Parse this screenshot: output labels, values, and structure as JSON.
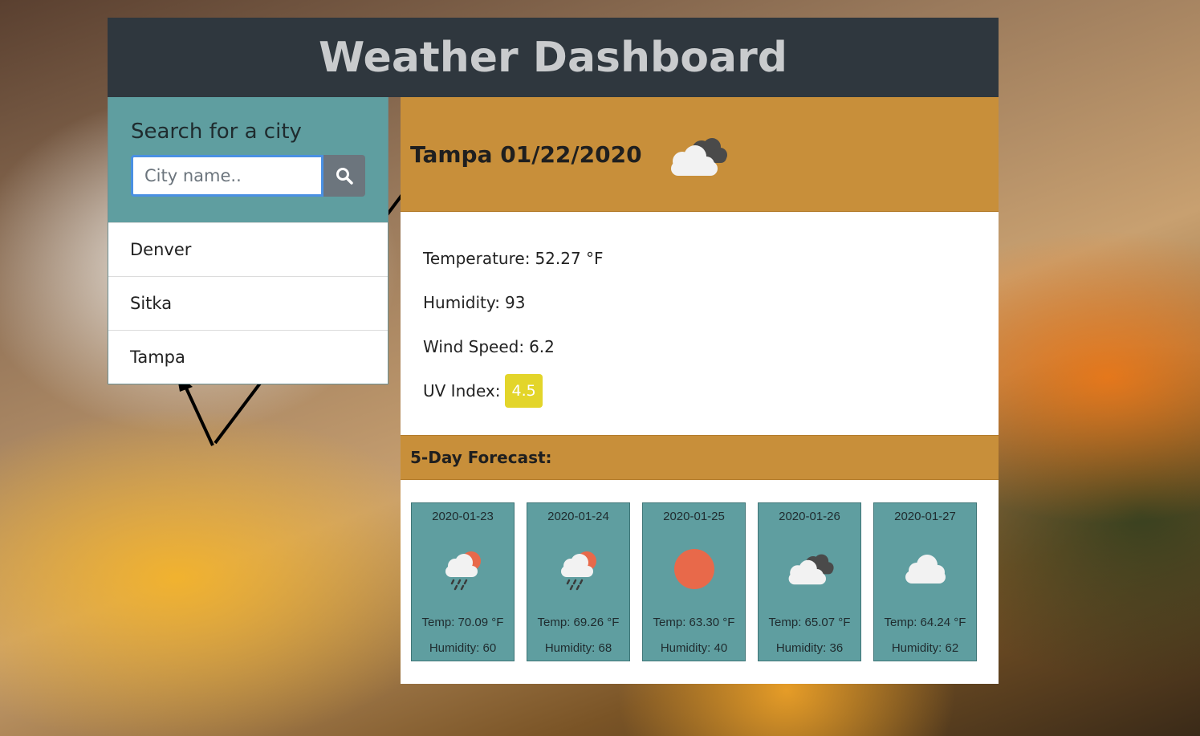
{
  "header": {
    "title": "Weather Dashboard"
  },
  "search": {
    "title": "Search for a city",
    "placeholder": "City name..",
    "button_icon": "search-icon"
  },
  "history": [
    {
      "label": "Denver"
    },
    {
      "label": "Sitka"
    },
    {
      "label": "Tampa"
    }
  ],
  "current": {
    "title": "Tampa 01/22/2020",
    "icon": "broken-clouds-icon",
    "temperature_label": "Temperature:",
    "temperature_value": "52.27 °F",
    "humidity_label": "Humidity:",
    "humidity_value": "93",
    "wind_label": "Wind Speed:",
    "wind_value": "6.2",
    "uv_label": "UV Index:",
    "uv_value": "4.5",
    "uv_color": "#e3d52a"
  },
  "forecast": {
    "title": "5-Day Forecast:",
    "days": [
      {
        "date": "2020-01-23",
        "icon": "rain-sun-icon",
        "temp": "Temp: 70.09 °F",
        "humidity": "Humidity: 60"
      },
      {
        "date": "2020-01-24",
        "icon": "rain-sun-icon",
        "temp": "Temp: 69.26 °F",
        "humidity": "Humidity: 68"
      },
      {
        "date": "2020-01-25",
        "icon": "sun-icon",
        "temp": "Temp: 63.30 °F",
        "humidity": "Humidity: 40"
      },
      {
        "date": "2020-01-26",
        "icon": "broken-clouds-icon",
        "temp": "Temp: 65.07 °F",
        "humidity": "Humidity: 36"
      },
      {
        "date": "2020-01-27",
        "icon": "cloud-icon",
        "temp": "Temp: 64.24 °F",
        "humidity": "Humidity: 62"
      }
    ]
  },
  "colors": {
    "header_bg": "#2f373e",
    "accent": "#c88f3a",
    "card_bg": "#5f9ea0",
    "sun": "#e8694a"
  }
}
